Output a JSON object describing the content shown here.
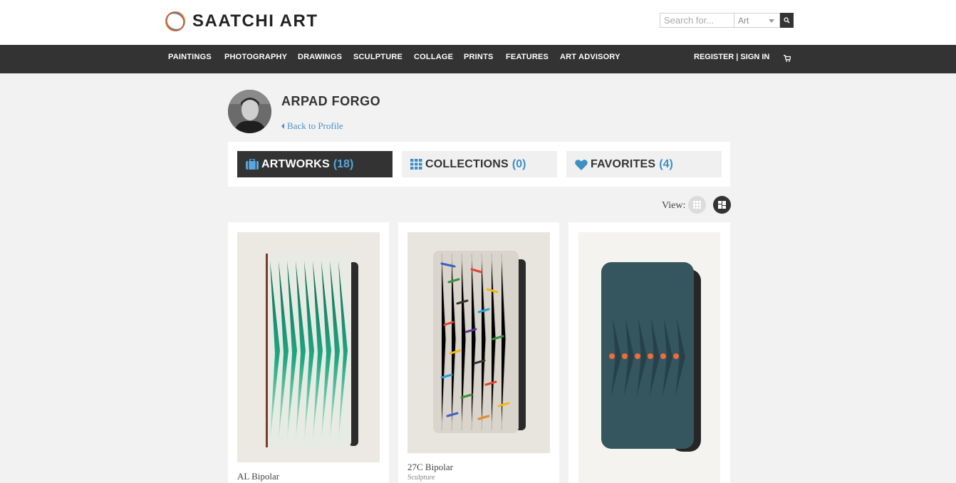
{
  "brand": {
    "name": "SAATCHI ART",
    "colors": {
      "ring_orange": "#f7941d",
      "ring_blue": "#2d9fd8",
      "ring_green": "#6cbf4b",
      "ring_red": "#e9473f",
      "accent_blue": "#3d8fc4"
    }
  },
  "search": {
    "placeholder": "Search for...",
    "category": "Art",
    "icon": "search-icon"
  },
  "nav": {
    "items": [
      "PAINTINGS",
      "PHOTOGRAPHY",
      "DRAWINGS",
      "SCULPTURE",
      "COLLAGE",
      "PRINTS",
      "FEATURES",
      "ART ADVISORY"
    ],
    "auth": "REGISTER | SIGN IN",
    "cart_icon": "cart-icon"
  },
  "profile": {
    "artist_name": "ARPAD FORGO",
    "back_link": "Back to Profile"
  },
  "tabs": [
    {
      "label": "ARTWORKS",
      "count": "(18)",
      "icon": "briefcase-icon",
      "active": true
    },
    {
      "label": "COLLECTIONS",
      "count": "(0)",
      "icon": "grid-icon",
      "active": false
    },
    {
      "label": "FAVORITES",
      "count": "(4)",
      "icon": "heart-icon",
      "active": false
    }
  ],
  "view": {
    "label": "View:",
    "options": [
      "grid-view-icon",
      "masonry-view-icon"
    ],
    "selected": "masonry-view-icon"
  },
  "artworks": [
    {
      "title": "AL Bipolar",
      "category": "",
      "palette": [
        "#2bb58c",
        "#e8ede5"
      ]
    },
    {
      "title": "27C Bipolar",
      "category": "Sculpture",
      "palette": [
        "#d7d2c9",
        "#e9483b",
        "#f5c21b",
        "#3179c9"
      ]
    },
    {
      "title": "",
      "category": "",
      "palette": [
        "#35565f",
        "#f26b38"
      ]
    }
  ]
}
